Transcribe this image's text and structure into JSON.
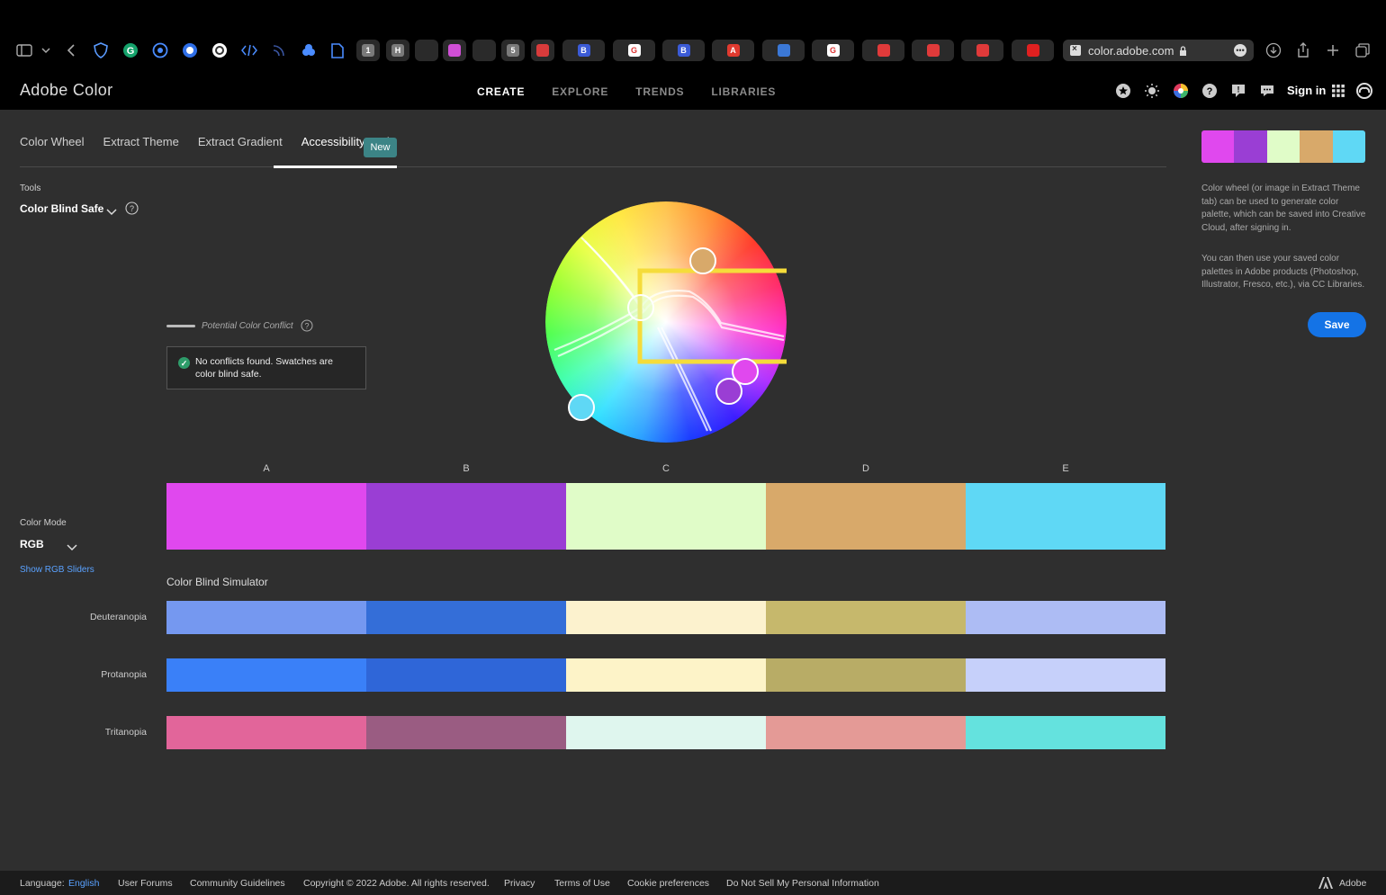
{
  "browser": {
    "url": "color.adobe.com",
    "tabs": [
      {
        "label": "1",
        "color": "#7a7a7a"
      },
      {
        "label": "H",
        "color": "#7a7a7a"
      },
      {
        "label": "",
        "color": "#2a2a2a"
      },
      {
        "label": "",
        "color": "#d04fd6"
      },
      {
        "label": "",
        "color": "#2a2a2a"
      },
      {
        "label": "5",
        "color": "#7a7a7a"
      },
      {
        "label": "",
        "color": "#d83b3b"
      },
      {
        "label": "B",
        "color": "#3b5bd6"
      },
      {
        "label": "G",
        "color": "#ffffff"
      },
      {
        "label": "B",
        "color": "#3b5bd6"
      },
      {
        "label": "A",
        "color": "#e03a2f"
      },
      {
        "label": "",
        "color": "#3b78d6"
      },
      {
        "label": "G",
        "color": "#ffffff"
      },
      {
        "label": "",
        "color": "#e03a3a"
      },
      {
        "label": "",
        "color": "#e03a3a"
      },
      {
        "label": "",
        "color": "#e03a3a"
      },
      {
        "label": "",
        "color": "#e02020"
      }
    ]
  },
  "app": {
    "title": "Adobe Color",
    "nav": [
      "CREATE",
      "EXPLORE",
      "TRENDS",
      "LIBRARIES"
    ],
    "nav_active": "CREATE",
    "signin": "Sign in"
  },
  "subtabs": {
    "items": [
      "Color Wheel",
      "Extract Theme",
      "Extract Gradient",
      "Accessibility Tools"
    ],
    "active": "Accessibility Tools",
    "new_badge": "New"
  },
  "tools": {
    "label": "Tools",
    "selected": "Color Blind Safe"
  },
  "conflict": {
    "legend": "Potential Color Conflict",
    "message": "No conflicts found. Swatches are color blind safe."
  },
  "swatches": {
    "letters": [
      "A",
      "B",
      "C",
      "D",
      "E"
    ],
    "colors": [
      "#e048ee",
      "#9a3ed4",
      "#e0fcc8",
      "#d8a96a",
      "#5fd8f5"
    ]
  },
  "color_mode": {
    "label": "Color Mode",
    "value": "RGB",
    "sliders_link": "Show RGB Sliders"
  },
  "simulator": {
    "title": "Color Blind Simulator",
    "rows": [
      {
        "name": "Deuteranopia",
        "colors": [
          "#7598f0",
          "#346ed8",
          "#fcf2ce",
          "#c6b86c",
          "#adbcf4"
        ]
      },
      {
        "name": "Protanopia",
        "colors": [
          "#3a80f8",
          "#2f66d8",
          "#fdf3c8",
          "#b8ac66",
          "#c6d0fa"
        ]
      },
      {
        "name": "Tritanopia",
        "colors": [
          "#e2659a",
          "#9a5c82",
          "#dff6ee",
          "#e49a96",
          "#64e2de"
        ]
      }
    ]
  },
  "side_panel": {
    "text1": "Color wheel (or image in Extract Theme tab) can be used to generate color palette, which can be saved into Creative Cloud, after signing in.",
    "text2": "You can then use your saved color palettes in Adobe products (Photoshop, Illustrator, Fresco, etc.), via CC Libraries.",
    "save": "Save"
  },
  "footer": {
    "language_label": "Language:",
    "language": "English",
    "links": [
      "User Forums",
      "Community Guidelines",
      "Copyright © 2022 Adobe. All rights reserved.",
      "Privacy",
      "Terms of Use",
      "Cookie preferences",
      "Do Not Sell My Personal Information"
    ],
    "brand": "Adobe"
  }
}
